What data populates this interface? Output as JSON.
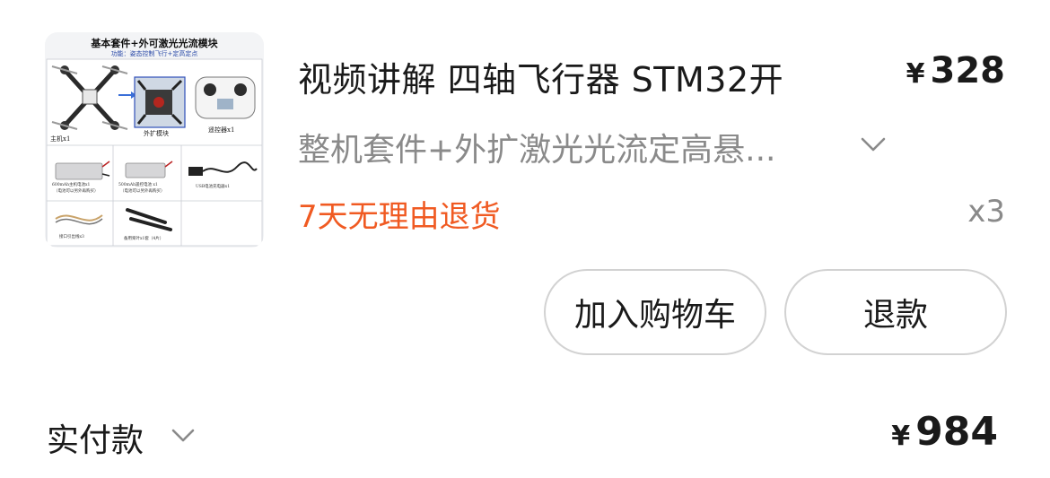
{
  "thumbnail": {
    "title": "基本套件+外可激光光流模块",
    "subtitle": "功能：姿态控制飞行+定高定点",
    "cells": {
      "drone": "主机x1",
      "module": "外扩模块",
      "remote": "遥控器x1",
      "battery1": "600mAh主机电池x1",
      "battery1_note": "（电池可以另外再购买）",
      "battery2": "500mAh遥控电池 x1",
      "battery2_note": "（电池可以另外再购买）",
      "charger": "USB电池充电器x1",
      "cable": "接口引出线x3",
      "props": "备用桨叶x1套（4片）"
    }
  },
  "product": {
    "title": "视频讲解 四轴飞行器 STM32开",
    "currency": "¥",
    "price": "328",
    "spec": "整机套件+外扩激光光流定高悬...",
    "returns_tag": "7天无理由退货",
    "quantity": "x3"
  },
  "actions": {
    "add_to_cart": "加入购物车",
    "refund": "退款"
  },
  "footer": {
    "paid_label": "实付款",
    "currency": "¥",
    "total": "984"
  },
  "colors": {
    "accent_orange": "#f05a22",
    "muted_gray": "#8a8a8a",
    "button_border": "#d2d2d2"
  },
  "icons": {
    "spec_toggle": "chevron-down-icon",
    "paid_toggle": "chevron-down-icon"
  }
}
